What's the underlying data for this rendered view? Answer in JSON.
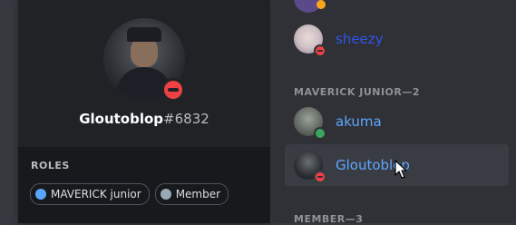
{
  "profile": {
    "username": "Gloutoblop",
    "discriminator": "#6832",
    "status": "dnd"
  },
  "roles": {
    "title": "ROLES",
    "items": [
      {
        "label": "MAVERICK junior",
        "color": "#58a6ff"
      },
      {
        "label": "Member",
        "color": "#99aab5"
      }
    ]
  },
  "member_list": {
    "sections": [
      {
        "title": "MAVERICK JUNIOR—2"
      },
      {
        "title": "MEMBER—3"
      }
    ],
    "members": [
      {
        "name": "sheezy",
        "color": "#2f54eb",
        "status": "dnd"
      },
      {
        "name": "akuma",
        "color": "#5ea7ff",
        "status": "online"
      },
      {
        "name": "Gloutoblop",
        "color": "#5ea7ff",
        "status": "dnd"
      }
    ]
  },
  "colors": {
    "dnd": "#ed4245",
    "online": "#3ba55d"
  }
}
